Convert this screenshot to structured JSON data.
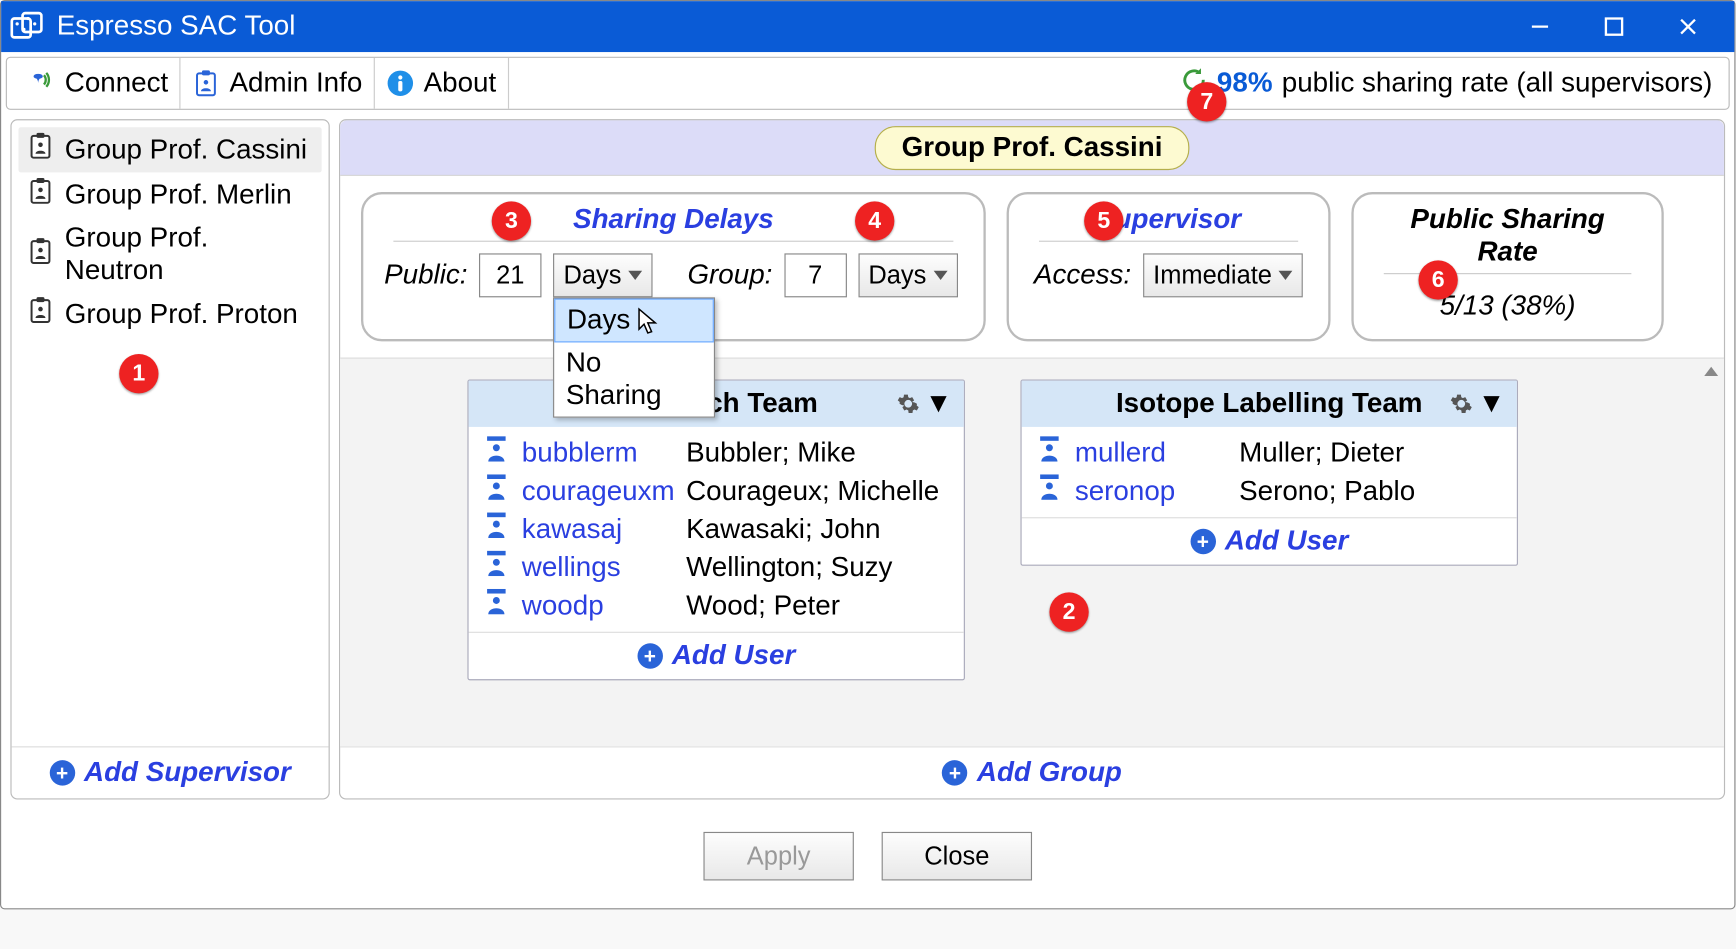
{
  "window": {
    "title": "Espresso SAC Tool"
  },
  "toolbar": {
    "connect": "Connect",
    "admin_info": "Admin Info",
    "about": "About",
    "sharing_rate_pct": "98%",
    "sharing_rate_text": "public sharing rate (all supervisors)"
  },
  "sidebar": {
    "items": [
      {
        "label": "Group Prof. Cassini",
        "selected": true
      },
      {
        "label": "Group Prof. Merlin",
        "selected": false
      },
      {
        "label": "Group Prof. Neutron",
        "selected": false
      },
      {
        "label": "Group Prof. Proton",
        "selected": false
      }
    ],
    "add_label": "Add Supervisor"
  },
  "main": {
    "group_name": "Group Prof. Cassini",
    "delays": {
      "title": "Sharing Delays",
      "public_label": "Public:",
      "public_value": "21",
      "public_unit": "Days",
      "group_label": "Group:",
      "group_value": "7",
      "group_unit": "Days",
      "dropdown_options": [
        "Days",
        "No Sharing"
      ]
    },
    "supervisor": {
      "title": "Supervisor",
      "access_label": "Access:",
      "access_value": "Immediate"
    },
    "rate": {
      "title": "Public Sharing Rate",
      "value": "5/13 (38%)"
    },
    "teams": [
      {
        "name": "Research Team",
        "members": [
          {
            "uname": "bubblerm",
            "full": "Bubbler; Mike"
          },
          {
            "uname": "courageuxm",
            "full": "Courageux; Michelle"
          },
          {
            "uname": "kawasaj",
            "full": "Kawasaki; John"
          },
          {
            "uname": "wellings",
            "full": "Wellington; Suzy"
          },
          {
            "uname": "woodp",
            "full": "Wood; Peter"
          }
        ]
      },
      {
        "name": "Isotope Labelling Team",
        "members": [
          {
            "uname": "mullerd",
            "full": "Muller; Dieter"
          },
          {
            "uname": "seronop",
            "full": "Serono; Pablo"
          }
        ]
      }
    ],
    "add_user_label": "Add User",
    "add_group_label": "Add Group"
  },
  "buttons": {
    "apply": "Apply",
    "close": "Close"
  },
  "markers": [
    "1",
    "2",
    "3",
    "4",
    "5",
    "6",
    "7"
  ]
}
